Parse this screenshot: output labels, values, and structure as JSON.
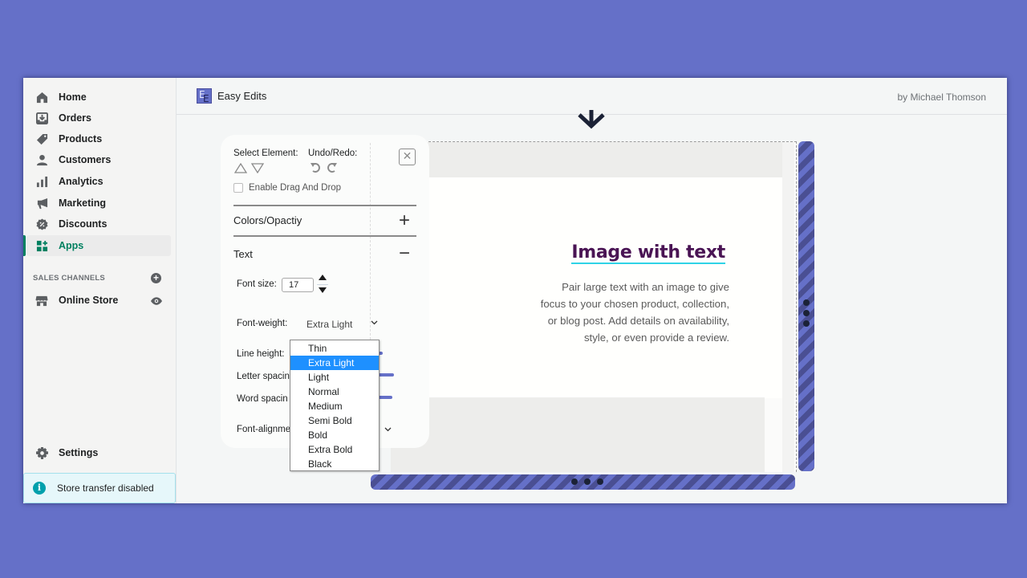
{
  "sidebar": {
    "items": [
      {
        "label": "Home",
        "icon": "home-icon"
      },
      {
        "label": "Orders",
        "icon": "orders-icon"
      },
      {
        "label": "Products",
        "icon": "tag-icon"
      },
      {
        "label": "Customers",
        "icon": "person-icon"
      },
      {
        "label": "Analytics",
        "icon": "bar-chart-icon"
      },
      {
        "label": "Marketing",
        "icon": "megaphone-icon"
      },
      {
        "label": "Discounts",
        "icon": "discount-icon"
      },
      {
        "label": "Apps",
        "icon": "apps-icon",
        "active": true
      }
    ],
    "sales_channels_heading": "SALES CHANNELS",
    "online_store": "Online Store",
    "settings": "Settings",
    "transfer_notice": "Store transfer disabled",
    "active_color": "#008060"
  },
  "header": {
    "app_logo_letters": [
      "E",
      "E"
    ],
    "app_title": "Easy Edits",
    "author": "by Michael Thomson"
  },
  "panel": {
    "select_element_label": "Select Element:",
    "undo_redo_label": "Undo/Redo:",
    "close_symbol": "✕",
    "drag_drop_label": "Enable Drag And Drop",
    "drag_drop_checked": false,
    "colors_section": "Colors/Opactiy",
    "colors_toggle": "+",
    "text_section": "Text",
    "text_toggle": "−",
    "font_size_label": "Font size:",
    "font_size_value": "17",
    "font_weight_label": "Font-weight:",
    "font_weight_value": "Extra Light",
    "line_height_label": "Line height:",
    "letter_spacing_label": "Letter spacin",
    "word_spacing_label": "Word spacin",
    "font_alignment_label": "Font-alignme"
  },
  "font_weight_options": [
    "Thin",
    "Extra Light",
    "Light",
    "Normal",
    "Medium",
    "Semi Bold",
    "Bold",
    "Extra Bold",
    "Black"
  ],
  "font_weight_selected_index": 1,
  "preview": {
    "heading": "Image with text",
    "paragraph": "Pair large text with an image to give focus to your chosen product, collection, or blog post. Add details on availability, style, or even provide a review.",
    "heading_color": "#4a1454",
    "underline_color": "#2fd3e6"
  },
  "colors": {
    "background": "#6570c8",
    "handle_stripe_dark": "#4a4f93",
    "dropdown_highlight": "#1e90ff"
  }
}
